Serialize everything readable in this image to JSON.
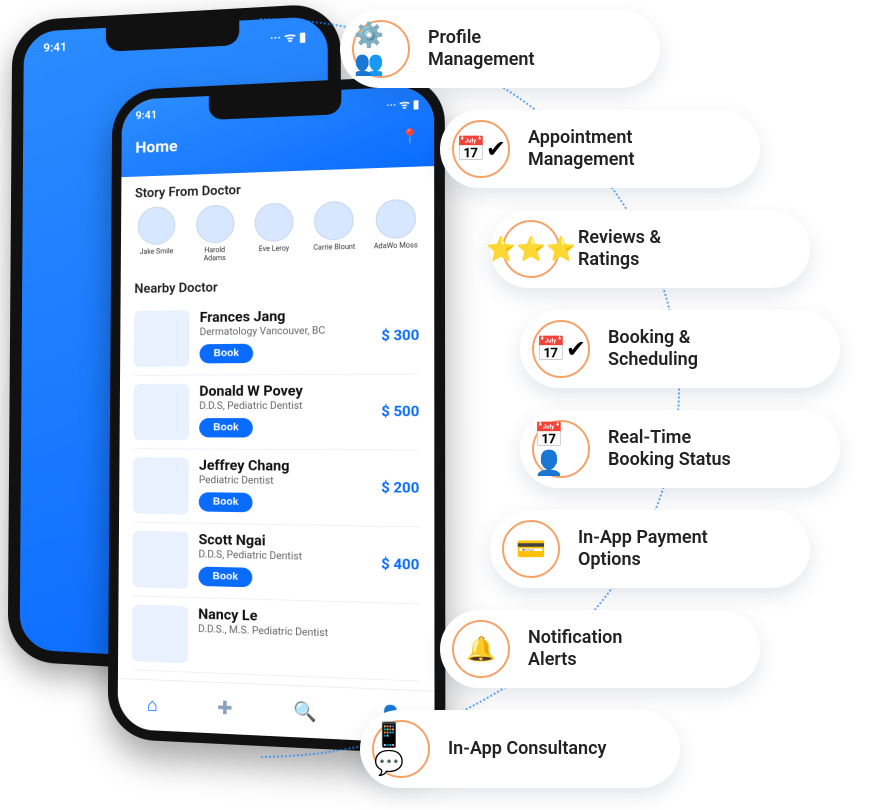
{
  "status_time": "9:41",
  "status_icons": "··· ᯤ ▮",
  "app": {
    "title": "Home",
    "location_icon": "📍",
    "story_header": "Story From Doctor",
    "nearby_header": "Nearby Doctor",
    "stories": [
      {
        "name": "Jake Smile"
      },
      {
        "name": "Harold Adams"
      },
      {
        "name": "Eve Leroy"
      },
      {
        "name": "Carrie Blount"
      },
      {
        "name": "AdaWo Moss"
      }
    ],
    "doctors": [
      {
        "name": "Frances Jang",
        "spec": "Dermatology  Vancouver, BC",
        "price": "$ 300",
        "book": "Book"
      },
      {
        "name": "Donald W Povey",
        "spec": "D.D.S, Pediatric Dentist",
        "price": "$ 500",
        "book": "Book"
      },
      {
        "name": "Jeffrey Chang",
        "spec": "Pediatric Dentist",
        "price": "$ 200",
        "book": "Book"
      },
      {
        "name": "Scott Ngai",
        "spec": "D.D.S, Pediatric Dentist",
        "price": "$ 400",
        "book": "Book"
      },
      {
        "name": "Nancy Le",
        "spec": "D.D.S., M.S. Pediatric Dentist",
        "price": "",
        "book": ""
      }
    ]
  },
  "features": [
    {
      "icon": "⚙️👥",
      "label": "Profile\nManagement"
    },
    {
      "icon": "📅✔",
      "label": "Appointment\nManagement"
    },
    {
      "icon": "⭐⭐⭐",
      "label": "Reviews &\nRatings"
    },
    {
      "icon": "📅✔",
      "label": "Booking &\nScheduling"
    },
    {
      "icon": "📅👤",
      "label": "Real-Time\nBooking Status"
    },
    {
      "icon": "💳",
      "label": "In-App Payment\nOptions"
    },
    {
      "icon": "🔔",
      "label": "Notification\nAlerts"
    },
    {
      "icon": "📱💬",
      "label": "In-App Consultancy"
    }
  ]
}
